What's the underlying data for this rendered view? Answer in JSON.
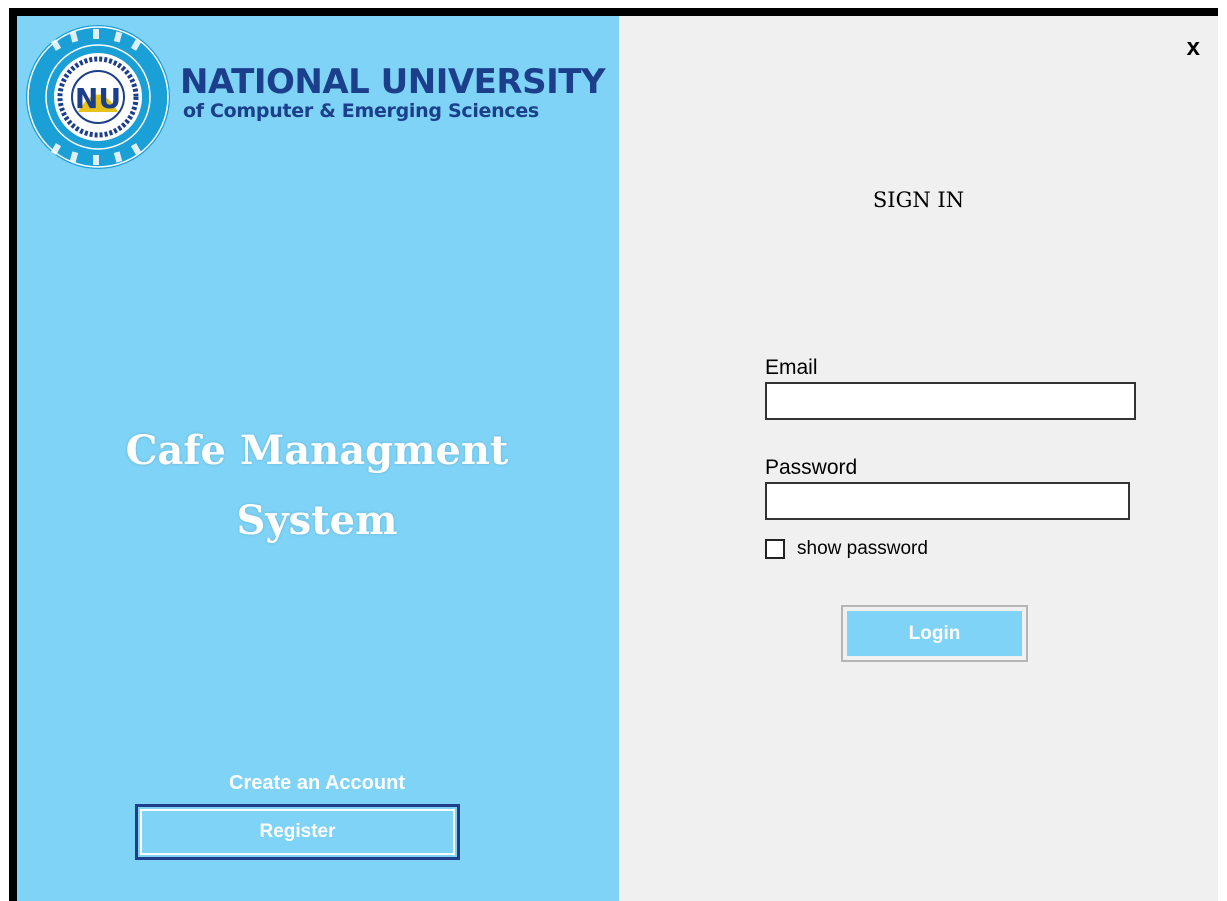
{
  "branding": {
    "university_name": "NATIONAL UNIVERSITY",
    "university_subtitle": "of Computer & Emerging Sciences",
    "seal_text": "NU"
  },
  "left_panel": {
    "app_title_line1": "Cafe Managment",
    "app_title_line2": "System",
    "create_account_label": "Create an Account",
    "register_label": "Register"
  },
  "right_panel": {
    "close_label": "x",
    "heading": "SIGN IN",
    "email_label": "Email",
    "email_value": "",
    "password_label": "Password",
    "password_value": "",
    "show_password_label": "show password",
    "show_password_checked": false,
    "login_label": "Login"
  },
  "colors": {
    "left_background": "#7ed3f7",
    "right_background": "#f0f0f0",
    "brand_blue": "#1c3f8c",
    "seal_ring": "#1a9fd6"
  }
}
